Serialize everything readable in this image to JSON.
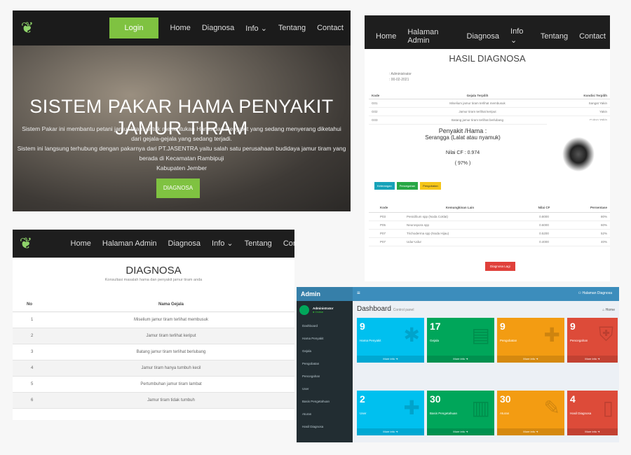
{
  "p1": {
    "nav": [
      "Login",
      "Home",
      "Diagnosa",
      "Info ⌄",
      "Tentang",
      "Contact"
    ],
    "title": "SISTEM PAKAR HAMA PENYAKIT JAMUR TIRAM",
    "sub1": "Sistem Pakar ini membantu petani jamur tiram untuk menentukan Hama dan Penyakit yang sedang menyerang diketahui dari gejala-gejala yang sedang terjadi.",
    "sub2": "Sistem ini langsung terhubung dengan pakarnya dari PT.JASENTRA yaitu salah satu perusahaan budidaya jamur tiram yang berada di Kecamatan Rambipuji",
    "sub3": "Kabupaten Jember",
    "btn": "DIAGNOSA"
  },
  "p2": {
    "nav": [
      "Home",
      "Halaman Admin",
      "Diagnosa",
      "Info ⌄",
      "Tentang",
      "Contact"
    ],
    "title": "HASIL DIAGNOSA",
    "user": ": Administrator",
    "date": ": 00-02-2021",
    "head": [
      "Kode",
      "Gejala Terpilih",
      "Kondisi Terpilih"
    ],
    "rows": [
      [
        "G01",
        "Miselium jamur tiram terlihat membusuk",
        "Sangat Yakin"
      ],
      [
        "G02",
        "Jamur tiram terlihat keriput",
        "Yakin"
      ],
      [
        "G03",
        "Batang jamur tiram terlihat berlubang",
        "Cukup Yakin"
      ]
    ],
    "result_label": "Penyakit /Hama :",
    "result": "Serangga (Lalat atau nyamuk)",
    "cf": "Nilai CF : 0.974",
    "pct": "( 97% )",
    "tabs": [
      "Keterangan",
      "Pencegahan",
      "Pengobatan"
    ],
    "head2": [
      "Kode",
      "Kemungkinan Lain",
      "Nilai CF",
      "Persentase"
    ],
    "rows2": [
      [
        "P03",
        "Penicillium spp (Noda Coklat)",
        "0.8000",
        "80%"
      ],
      [
        "P05",
        "Neurospora spp",
        "0.6000",
        "60%"
      ],
      [
        "P07",
        "Trichoderma spp (Noda Hijau)",
        "0.5200",
        "52%"
      ],
      [
        "P07",
        "Udur-Udur",
        "0.4000",
        "40%"
      ]
    ],
    "again": "Diagnosa Lagi"
  },
  "p3": {
    "nav": [
      "Home",
      "Halaman Admin",
      "Diagnosa",
      "Info ⌄",
      "Tentang",
      "Con"
    ],
    "title": "DIAGNOSA",
    "sub": "Konsultasi masalah hama dan penyakit jamur tiram anda",
    "head": [
      "No",
      "Nama Gejala"
    ],
    "rows": [
      [
        "1",
        "Miselium jamur tiram terlihat membusuk"
      ],
      [
        "2",
        "Jamur tiram terlihat keriput"
      ],
      [
        "3",
        "Batang jamur tiram terlihat berlubang"
      ],
      [
        "4",
        "Jamur tiram hanya tumbuh kecil"
      ],
      [
        "5",
        "Pertumbuhan jamur tiram lambat"
      ],
      [
        "6",
        "Jamur tiram tidak tumbuh"
      ]
    ]
  },
  "p4": {
    "brand": "Admin JASENTRA",
    "user": "Administrator",
    "online": "● Online",
    "top_right": "⚇ Halaman Diagnosa",
    "dash": "Dashboard",
    "dash_sub": "Control panel",
    "home": "⌂ Home",
    "menu": [
      "Dashboard",
      "Hama Penyakit",
      "Gejala",
      "Pengobatan",
      "Pencegahan",
      "User",
      "Basis Pengetahuan",
      "Aturan",
      "Hasil Diagnosa"
    ],
    "boxes": [
      {
        "n": "9",
        "l": "Hama Penyakit",
        "c": "#00c0ef",
        "i": "✱"
      },
      {
        "n": "17",
        "l": "Gejala",
        "c": "#00a65a",
        "i": "▤"
      },
      {
        "n": "9",
        "l": "Pengobatan",
        "c": "#f39c12",
        "i": "✚"
      },
      {
        "n": "9",
        "l": "Pencegahan",
        "c": "#dd4b39",
        "i": "⛨"
      },
      {
        "n": "2",
        "l": "User",
        "c": "#00c0ef",
        "i": "✚"
      },
      {
        "n": "30",
        "l": "Basis Pengetahuan",
        "c": "#00a65a",
        "i": "▥"
      },
      {
        "n": "30",
        "l": "Aturan",
        "c": "#f39c12",
        "i": "✎"
      },
      {
        "n": "4",
        "l": "Hasil Diagnosa",
        "c": "#dd4b39",
        "i": "▯"
      }
    ],
    "more": "More info ➜"
  }
}
